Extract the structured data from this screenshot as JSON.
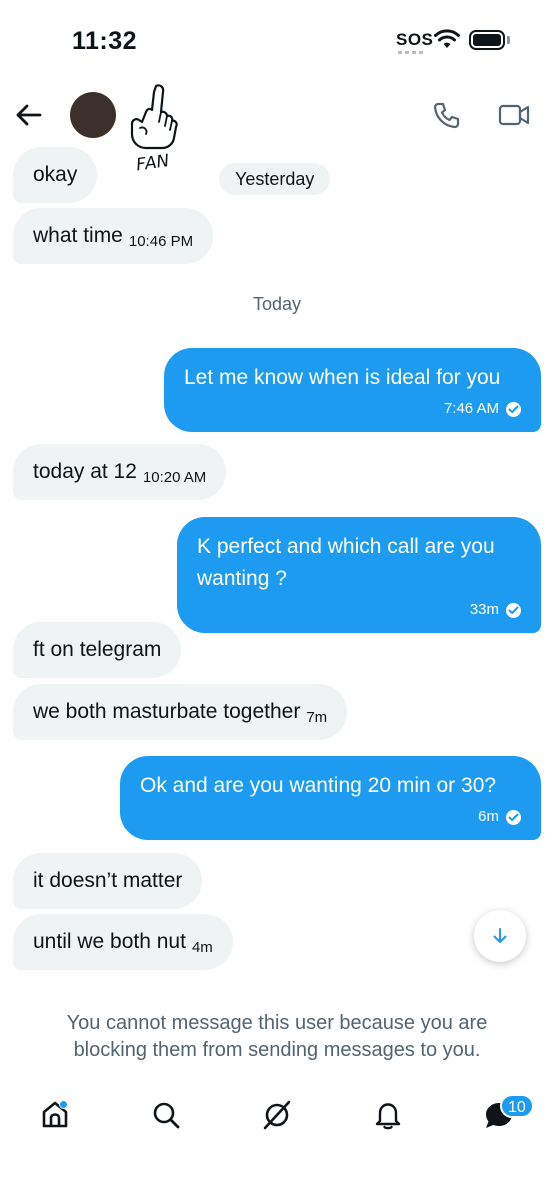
{
  "status_bar": {
    "time": "11:32",
    "sos": "SOS"
  },
  "header": {
    "sticker_text": "FAN"
  },
  "day_dividers": {
    "yesterday": "Yesterday",
    "today": "Today"
  },
  "messages": [
    {
      "direction": "in",
      "text": "okay",
      "time": ""
    },
    {
      "direction": "in",
      "text": "what time",
      "time": "10:46 PM"
    },
    {
      "direction": "out",
      "text": "Let me know when is ideal for you",
      "time": "7:46 AM"
    },
    {
      "direction": "in",
      "text": "today at 12",
      "time": "10:20 AM"
    },
    {
      "direction": "out",
      "text": "K perfect and which call are you wanting ?",
      "time": "33m"
    },
    {
      "direction": "in",
      "text": "ft on telegram",
      "time": ""
    },
    {
      "direction": "in",
      "text": "we both masturbate together",
      "time": "7m"
    },
    {
      "direction": "out",
      "text": "Ok and are you wanting 20 min or 30?",
      "time": "6m"
    },
    {
      "direction": "in",
      "text": "it doesn’t matter",
      "time": ""
    },
    {
      "direction": "in",
      "text": "until we both nut",
      "time": "4m"
    }
  ],
  "blocked_notice": "You cannot message this user because you are blocking them from sending messages to you.",
  "bottom_nav": {
    "items": [
      "home-icon",
      "search-icon",
      "grok-icon",
      "notifications-icon",
      "messages-icon"
    ],
    "messages_badge": "10"
  },
  "colors": {
    "accent": "#1d9bf0",
    "incoming_bubble": "#eff3f4",
    "secondary_text": "#536471"
  }
}
